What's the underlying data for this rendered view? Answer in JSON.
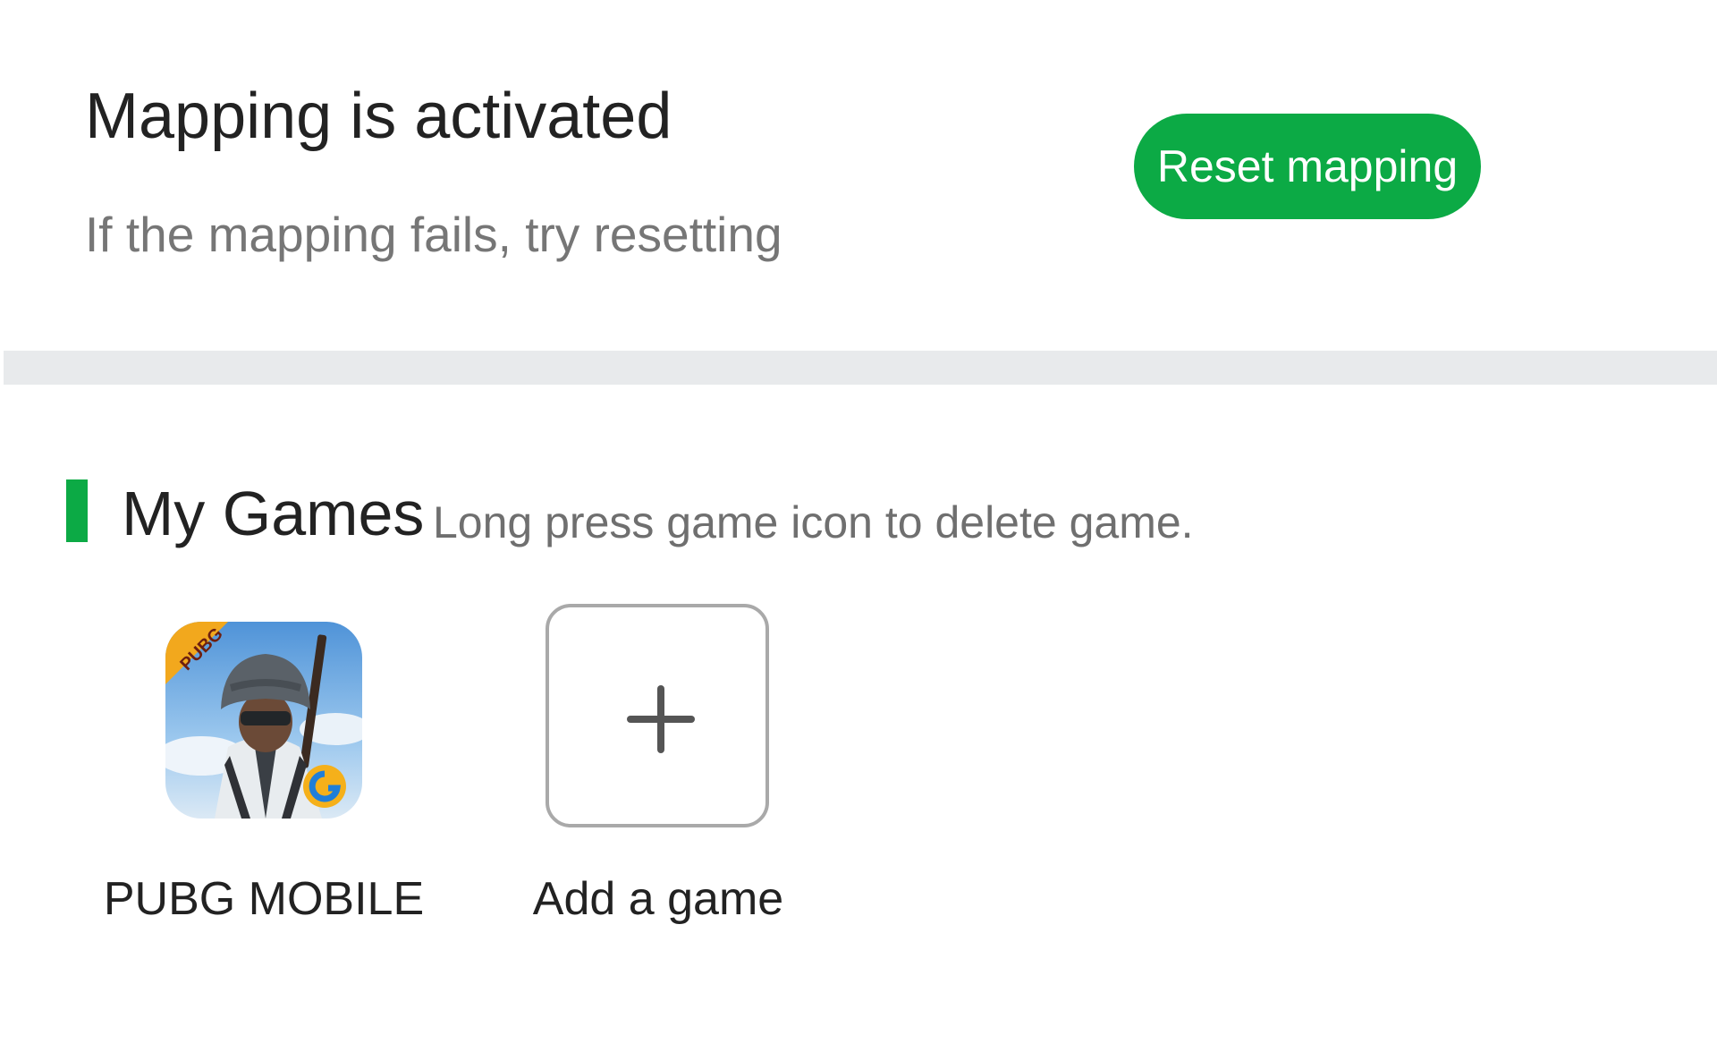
{
  "status": {
    "title": "Mapping is activated",
    "subtitle": "If the mapping fails, try resetting",
    "reset_button_label": "Reset mapping"
  },
  "colors": {
    "accent": "#0caa45",
    "divider": "#e8eaec",
    "secondary_text": "#767676"
  },
  "my_games": {
    "title": "My Games",
    "hint": "Long press game icon to delete game.",
    "games": [
      {
        "name": "PUBG MOBILE",
        "icon": "pubg-mobile-app-icon",
        "badge": "PUBG"
      }
    ],
    "add_game": {
      "label": "Add a game",
      "icon": "plus-icon"
    }
  }
}
